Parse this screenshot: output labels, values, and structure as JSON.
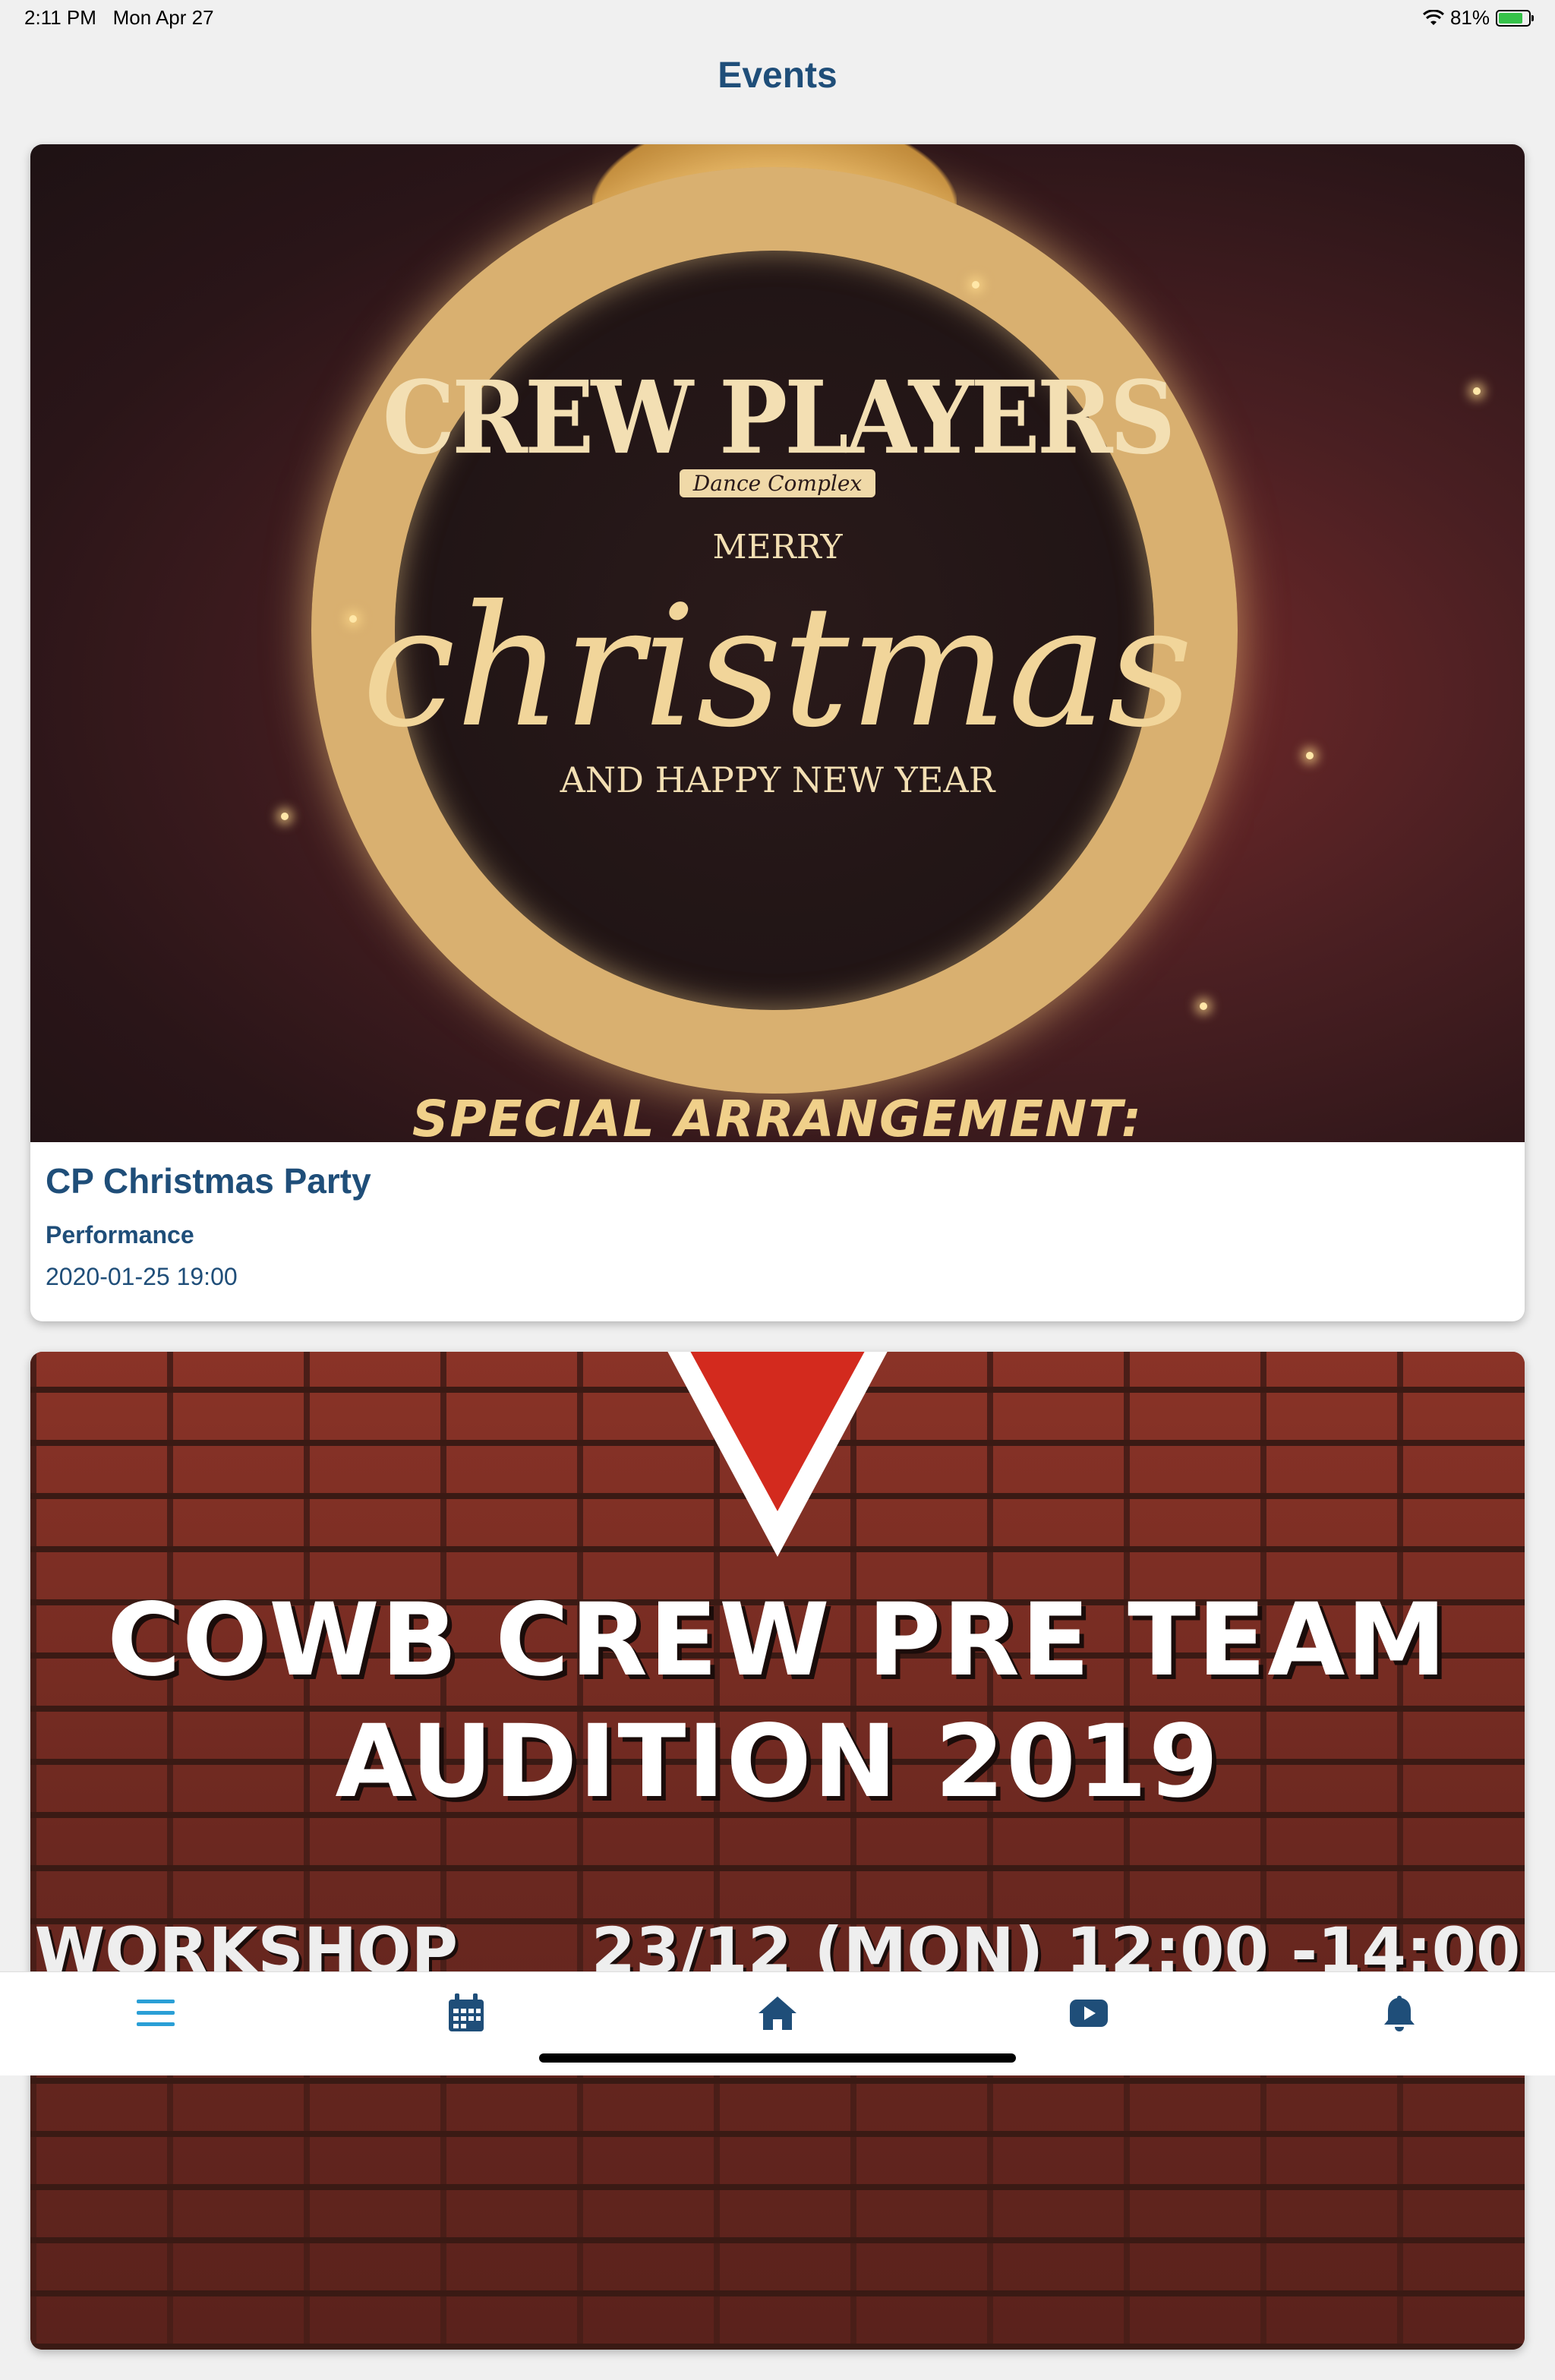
{
  "status_bar": {
    "time": "2:11 PM",
    "date": "Mon Apr 27",
    "battery": "81%",
    "battery_level": 0.81
  },
  "nav": {
    "title": "Events"
  },
  "events": [
    {
      "title": "CP Christmas Party",
      "type": "Performance",
      "datetime": "2020-01-25 19:00",
      "poster": {
        "brand": "CREW PLAYERS",
        "brand_sub": "Dance Complex",
        "line1": "MERRY",
        "line2": "christmas",
        "line3": "AND HAPPY NEW YEAR",
        "line4": "SPECIAL ARRANGEMENT:"
      }
    },
    {
      "poster": {
        "title_line1": "COWB CREW PRE TEAM",
        "title_line2": "AUDITION 2019",
        "workshop_label": "WORKSHOP",
        "workshop_time": "23/12 (MON) 12:00 -14:00"
      }
    }
  ],
  "tab_bar": {
    "items": [
      {
        "icon": "menu-icon"
      },
      {
        "icon": "calendar-icon"
      },
      {
        "icon": "home-icon"
      },
      {
        "icon": "video-icon"
      },
      {
        "icon": "bell-icon"
      }
    ],
    "active_color": "#2a9fd6",
    "icon_color": "#1f4e79"
  }
}
